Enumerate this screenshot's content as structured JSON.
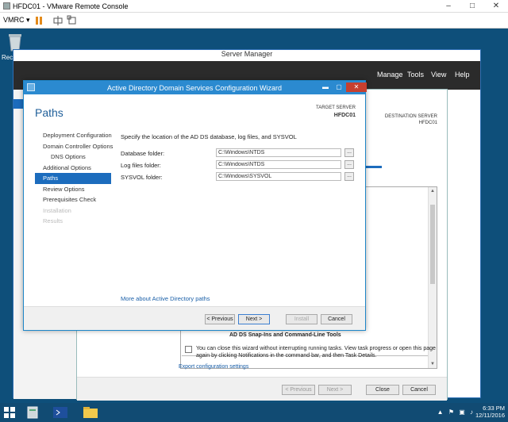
{
  "vmrc": {
    "title": "HFDC01 - VMware Remote Console",
    "menu_label": "VMRC ▾",
    "controls": [
      "–",
      "□",
      "✕"
    ]
  },
  "desktop": {
    "recycle_label": "Recy"
  },
  "server_manager": {
    "title": "Server Manager",
    "menus": [
      "Manage",
      "Tools",
      "View",
      "Help"
    ]
  },
  "background_wizard": {
    "dest_label": "DESTINATION SERVER",
    "dest_server": "HFDC01",
    "rsat_text": "AD DS Snap-Ins and Command-Line Tools",
    "note": "You can close this wizard without interrupting running tasks. View task progress or open this page again by clicking Notifications in the command bar, and then Task Details.",
    "export_link": "Export configuration settings",
    "buttons": {
      "previous": "< Previous",
      "next": "Next >",
      "close": "Close",
      "cancel": "Cancel"
    }
  },
  "wizard": {
    "title": "Active Directory Domain Services Configuration Wizard",
    "heading": "Paths",
    "target_label": "TARGET SERVER",
    "target_server": "HFDC01",
    "controls": {
      "min": "▬",
      "max": "▢",
      "close": "✕"
    },
    "nav": [
      {
        "label": "Deployment Configuration",
        "state": "normal",
        "sub": false
      },
      {
        "label": "Domain Controller Options",
        "state": "normal",
        "sub": false
      },
      {
        "label": "DNS Options",
        "state": "normal",
        "sub": true
      },
      {
        "label": "Additional Options",
        "state": "normal",
        "sub": false
      },
      {
        "label": "Paths",
        "state": "active",
        "sub": false
      },
      {
        "label": "Review Options",
        "state": "normal",
        "sub": false
      },
      {
        "label": "Prerequisites Check",
        "state": "normal",
        "sub": false
      },
      {
        "label": "Installation",
        "state": "disabled",
        "sub": false
      },
      {
        "label": "Results",
        "state": "disabled",
        "sub": false
      }
    ],
    "intro": "Specify the location of the AD DS database, log files, and SYSVOL",
    "fields": [
      {
        "label": "Database folder:",
        "value": "C:\\Windows\\NTDS",
        "browse": "..."
      },
      {
        "label": "Log files folder:",
        "value": "C:\\Windows\\NTDS",
        "browse": "..."
      },
      {
        "label": "SYSVOL folder:",
        "value": "C:\\Windows\\SYSVOL",
        "browse": "..."
      }
    ],
    "more_link": "More about Active Directory paths",
    "buttons": {
      "previous": "< Previous",
      "next": "Next >",
      "install": "Install",
      "cancel": "Cancel"
    }
  },
  "taskbar": {
    "time": "6:33 PM",
    "date": "12/11/2016"
  },
  "colors": {
    "wizard_titlebar": "#2b8ad0",
    "nav_active": "#1c6cbd",
    "desktop": "#0e4f7a",
    "link": "#1a5fa8"
  }
}
